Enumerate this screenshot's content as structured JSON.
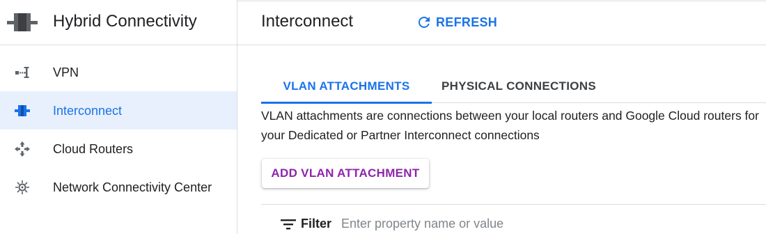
{
  "product": {
    "title": "Hybrid Connectivity",
    "icon": "interconnect-icon"
  },
  "sidebar": {
    "items": [
      {
        "label": "VPN",
        "icon": "vpn-icon",
        "active": false
      },
      {
        "label": "Interconnect",
        "icon": "interconnect-icon",
        "active": true
      },
      {
        "label": "Cloud Routers",
        "icon": "cloud-router-icon",
        "active": false
      },
      {
        "label": "Network Connectivity Center",
        "icon": "network-hub-icon",
        "active": false
      }
    ]
  },
  "header": {
    "title": "Interconnect",
    "refresh_label": "REFRESH"
  },
  "tabs": [
    {
      "label": "VLAN ATTACHMENTS",
      "active": true
    },
    {
      "label": "PHYSICAL CONNECTIONS",
      "active": false
    }
  ],
  "main": {
    "description": "VLAN attachments are connections between your local routers and Google Cloud routers for your Dedicated or Partner Interconnect connections",
    "add_button_label": "ADD VLAN ATTACHMENT"
  },
  "filter": {
    "label": "Filter",
    "placeholder": "Enter property name or value",
    "value": ""
  },
  "colors": {
    "accent": "#1a73e8",
    "active_bg": "#e8f0fe",
    "add_button_text": "#8e24aa",
    "divider": "#dadce0",
    "icon_gray": "#5f6368"
  }
}
